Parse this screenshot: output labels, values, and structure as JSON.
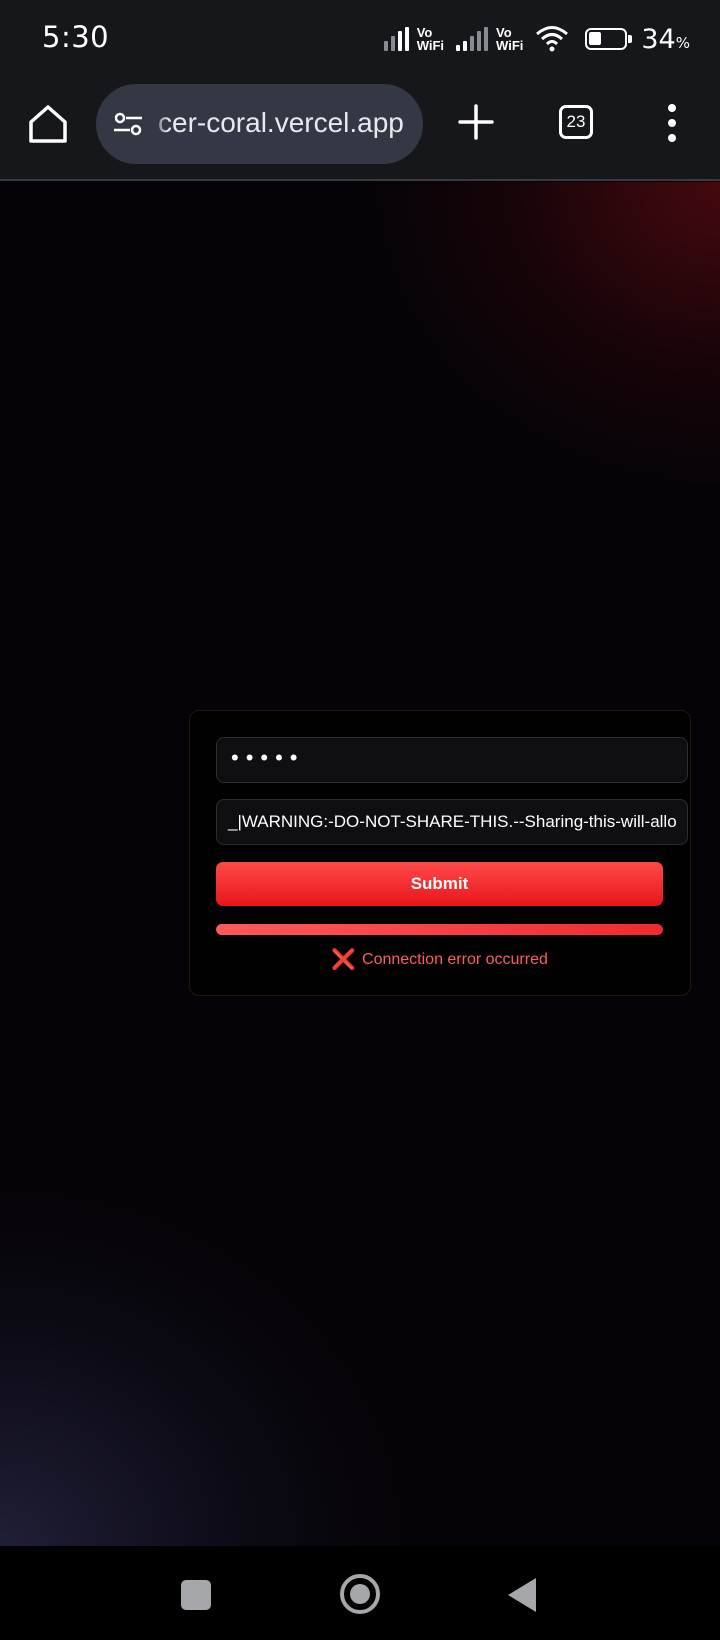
{
  "status_bar": {
    "time": "5:30",
    "vowifi_1": [
      "Vo",
      "WiFi"
    ],
    "vowifi_2": [
      "Vo",
      "WiFi"
    ],
    "battery_percent": "34",
    "battery_unit": "%",
    "battery_level": 0.34
  },
  "browser": {
    "url": "cer-coral.vercel.app",
    "tab_count": "23",
    "icons": {
      "home": "home-icon",
      "site_settings": "tune-icon",
      "new_tab": "plus-icon",
      "tabs": "tab-switcher-icon",
      "menu": "more-vert-icon"
    }
  },
  "form": {
    "password_value": "•••••",
    "key_value": "_|WARNING:-DO-NOT-SHARE-THIS.--Sharing-this-will-allo",
    "submit_label": "Submit",
    "progress": 1.0,
    "error_icon": "❌",
    "error_text": "Connection error occurred"
  },
  "colors": {
    "accent_red": "#f02a30",
    "error_text": "#ff5c5c",
    "card_bg": "#010101"
  },
  "nav_bar": {
    "icons": [
      "recents-square-icon",
      "home-circle-icon",
      "back-triangle-icon"
    ]
  }
}
